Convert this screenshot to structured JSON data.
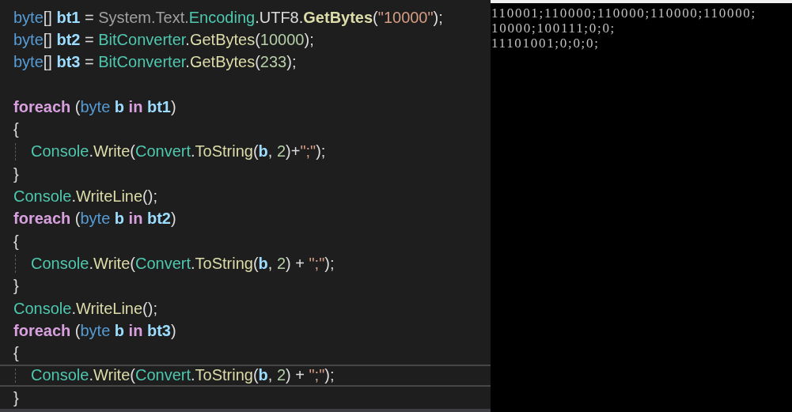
{
  "editor": {
    "lines": [
      {
        "indent": false,
        "current": false,
        "tokens": [
          {
            "kind": "keyword",
            "text": "byte"
          },
          {
            "kind": "plain",
            "text": "[] "
          },
          {
            "kind": "local",
            "text": "bt1"
          },
          {
            "kind": "plain",
            "text": " = "
          },
          {
            "kind": "dim",
            "text": "System.Text."
          },
          {
            "kind": "type",
            "text": "Encoding"
          },
          {
            "kind": "plain",
            "text": ".UTF8."
          },
          {
            "kind": "method_bold",
            "text": "GetBytes"
          },
          {
            "kind": "plain",
            "text": "("
          },
          {
            "kind": "string",
            "text": "\"10000\""
          },
          {
            "kind": "plain",
            "text": ");"
          }
        ]
      },
      {
        "indent": false,
        "current": false,
        "tokens": [
          {
            "kind": "keyword",
            "text": "byte"
          },
          {
            "kind": "plain",
            "text": "[] "
          },
          {
            "kind": "local",
            "text": "bt2"
          },
          {
            "kind": "plain",
            "text": " = "
          },
          {
            "kind": "type",
            "text": "BitConverter"
          },
          {
            "kind": "plain",
            "text": "."
          },
          {
            "kind": "method",
            "text": "GetBytes"
          },
          {
            "kind": "plain",
            "text": "("
          },
          {
            "kind": "number",
            "text": "10000"
          },
          {
            "kind": "plain",
            "text": ");"
          }
        ]
      },
      {
        "indent": false,
        "current": false,
        "tokens": [
          {
            "kind": "keyword",
            "text": "byte"
          },
          {
            "kind": "plain",
            "text": "[] "
          },
          {
            "kind": "local",
            "text": "bt3"
          },
          {
            "kind": "plain",
            "text": " = "
          },
          {
            "kind": "type",
            "text": "BitConverter"
          },
          {
            "kind": "plain",
            "text": "."
          },
          {
            "kind": "method",
            "text": "GetBytes"
          },
          {
            "kind": "plain",
            "text": "("
          },
          {
            "kind": "number",
            "text": "233"
          },
          {
            "kind": "plain",
            "text": ");"
          }
        ]
      },
      {
        "indent": false,
        "current": false
      },
      {
        "indent": false,
        "current": false,
        "tokens": [
          {
            "kind": "control",
            "text": "foreach"
          },
          {
            "kind": "plain",
            "text": " ("
          },
          {
            "kind": "keyword",
            "text": "byte"
          },
          {
            "kind": "local",
            "text": " b"
          },
          {
            "kind": "control",
            "text": " in"
          },
          {
            "kind": "local",
            "text": " bt1"
          },
          {
            "kind": "plain",
            "text": ")"
          }
        ]
      },
      {
        "indent": false,
        "current": false,
        "tokens": [
          {
            "kind": "plain",
            "text": "{"
          }
        ]
      },
      {
        "indent": true,
        "current": false,
        "tokens": [
          {
            "kind": "type",
            "text": "Console"
          },
          {
            "kind": "plain",
            "text": "."
          },
          {
            "kind": "method",
            "text": "Write"
          },
          {
            "kind": "plain",
            "text": "("
          },
          {
            "kind": "type",
            "text": "Convert"
          },
          {
            "kind": "plain",
            "text": "."
          },
          {
            "kind": "method",
            "text": "ToString"
          },
          {
            "kind": "plain",
            "text": "("
          },
          {
            "kind": "local",
            "text": "b"
          },
          {
            "kind": "plain",
            "text": ", "
          },
          {
            "kind": "number",
            "text": "2"
          },
          {
            "kind": "plain",
            "text": ")+"
          },
          {
            "kind": "string",
            "text": "\";\""
          },
          {
            "kind": "plain",
            "text": ");"
          }
        ]
      },
      {
        "indent": false,
        "current": false,
        "tokens": [
          {
            "kind": "plain",
            "text": "}"
          }
        ]
      },
      {
        "indent": false,
        "current": false,
        "tokens": [
          {
            "kind": "type",
            "text": "Console"
          },
          {
            "kind": "plain",
            "text": "."
          },
          {
            "kind": "method",
            "text": "WriteLine"
          },
          {
            "kind": "plain",
            "text": "();"
          }
        ]
      },
      {
        "indent": false,
        "current": false,
        "tokens": [
          {
            "kind": "control",
            "text": "foreach"
          },
          {
            "kind": "plain",
            "text": " ("
          },
          {
            "kind": "keyword",
            "text": "byte"
          },
          {
            "kind": "local",
            "text": " b"
          },
          {
            "kind": "control",
            "text": " in"
          },
          {
            "kind": "local",
            "text": " bt2"
          },
          {
            "kind": "plain",
            "text": ")"
          }
        ]
      },
      {
        "indent": false,
        "current": false,
        "tokens": [
          {
            "kind": "plain",
            "text": "{"
          }
        ]
      },
      {
        "indent": true,
        "current": false,
        "tokens": [
          {
            "kind": "type",
            "text": "Console"
          },
          {
            "kind": "plain",
            "text": "."
          },
          {
            "kind": "method",
            "text": "Write"
          },
          {
            "kind": "plain",
            "text": "("
          },
          {
            "kind": "type",
            "text": "Convert"
          },
          {
            "kind": "plain",
            "text": "."
          },
          {
            "kind": "method",
            "text": "ToString"
          },
          {
            "kind": "plain",
            "text": "("
          },
          {
            "kind": "local",
            "text": "b"
          },
          {
            "kind": "plain",
            "text": ", "
          },
          {
            "kind": "number",
            "text": "2"
          },
          {
            "kind": "plain",
            "text": ") + "
          },
          {
            "kind": "string",
            "text": "\";\""
          },
          {
            "kind": "plain",
            "text": ");"
          }
        ]
      },
      {
        "indent": false,
        "current": false,
        "tokens": [
          {
            "kind": "plain",
            "text": "}"
          }
        ]
      },
      {
        "indent": false,
        "current": false,
        "tokens": [
          {
            "kind": "type",
            "text": "Console"
          },
          {
            "kind": "plain",
            "text": "."
          },
          {
            "kind": "method",
            "text": "WriteLine"
          },
          {
            "kind": "plain",
            "text": "();"
          }
        ]
      },
      {
        "indent": false,
        "current": false,
        "tokens": [
          {
            "kind": "control",
            "text": "foreach"
          },
          {
            "kind": "plain",
            "text": " ("
          },
          {
            "kind": "keyword",
            "text": "byte"
          },
          {
            "kind": "local",
            "text": " b"
          },
          {
            "kind": "control",
            "text": " in"
          },
          {
            "kind": "local",
            "text": " bt3"
          },
          {
            "kind": "plain",
            "text": ")"
          }
        ]
      },
      {
        "indent": false,
        "current": false,
        "tokens": [
          {
            "kind": "plain",
            "text": "{"
          }
        ]
      },
      {
        "indent": true,
        "current": true,
        "tokens": [
          {
            "kind": "type",
            "text": "Console"
          },
          {
            "kind": "plain",
            "text": "."
          },
          {
            "kind": "method",
            "text": "Write"
          },
          {
            "kind": "plain",
            "text": "("
          },
          {
            "kind": "type",
            "text": "Convert"
          },
          {
            "kind": "plain",
            "text": "."
          },
          {
            "kind": "method",
            "text": "ToString"
          },
          {
            "kind": "plain",
            "text": "("
          },
          {
            "kind": "local",
            "text": "b"
          },
          {
            "kind": "plain",
            "text": ", "
          },
          {
            "kind": "number",
            "text": "2"
          },
          {
            "kind": "plain",
            "text": ") + "
          },
          {
            "kind": "string",
            "text": "\";\""
          },
          {
            "kind": "plain",
            "text": ");"
          }
        ]
      },
      {
        "indent": false,
        "current": false,
        "tokens": [
          {
            "kind": "plain",
            "text": "}"
          }
        ]
      }
    ]
  },
  "console": {
    "lines": [
      "110001;110000;110000;110000;110000;",
      "10000;100111;0;0;",
      "11101001;0;0;0;"
    ]
  }
}
